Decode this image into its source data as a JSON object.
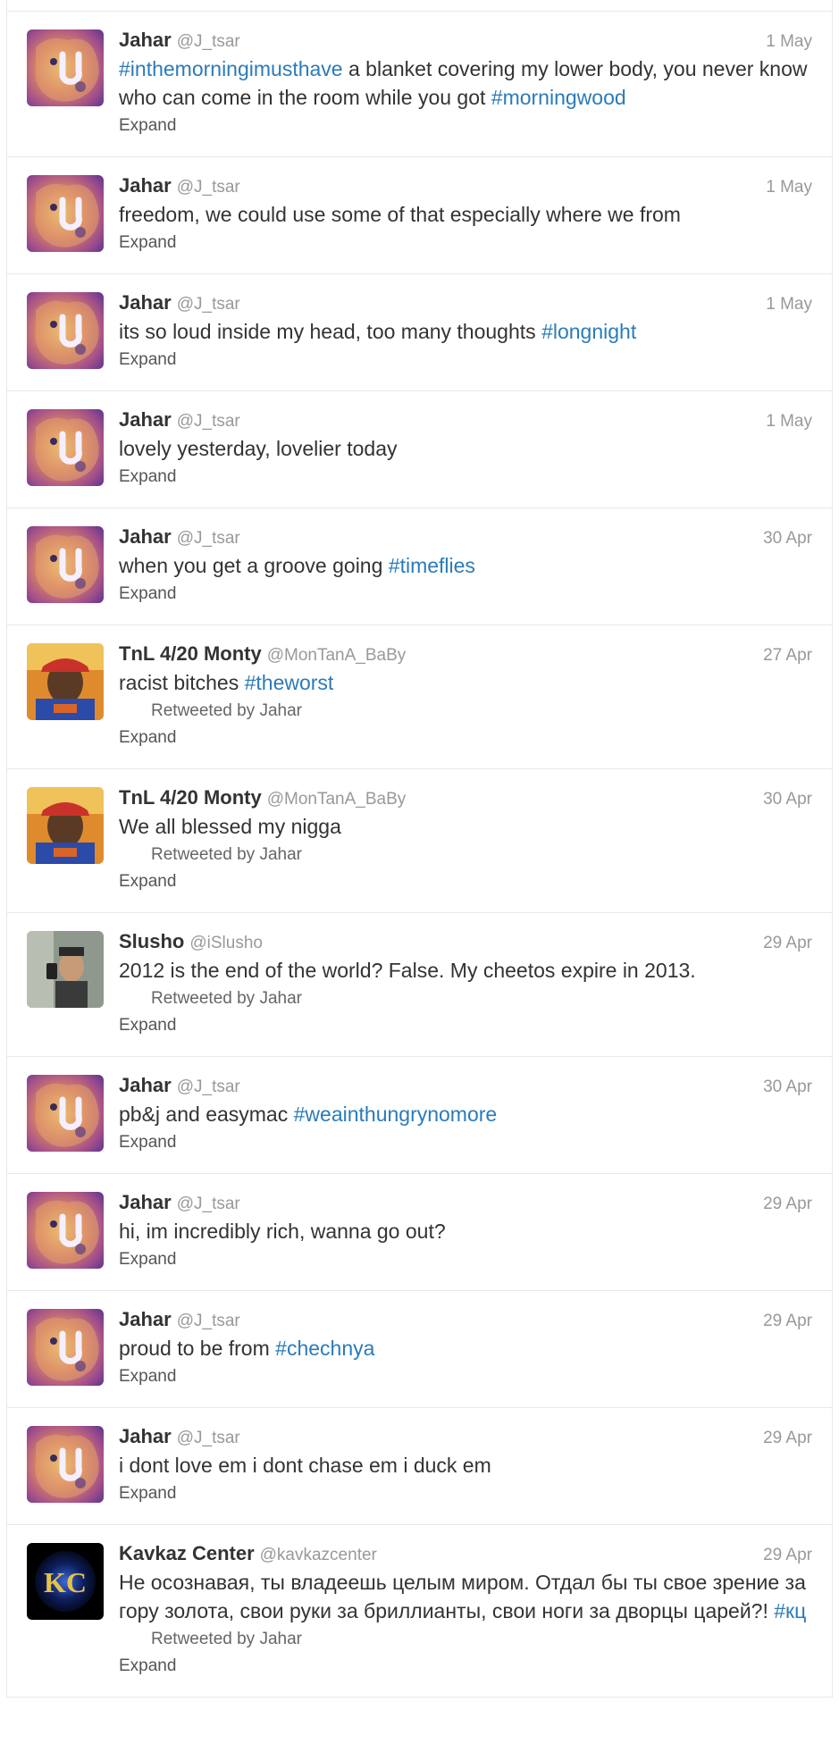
{
  "tweets": [
    {
      "avatar": "lion",
      "name": "Jahar",
      "handle": "@J_tsar",
      "time": "1 May",
      "text": [
        {
          "t": "#inthemorningimusthave",
          "tag": true
        },
        {
          "t": " a blanket covering my lower body, you never know who can come in the room while you got "
        },
        {
          "t": "#morningwood",
          "tag": true
        }
      ],
      "retweet": "",
      "expand": "Expand"
    },
    {
      "avatar": "lion",
      "name": "Jahar",
      "handle": "@J_tsar",
      "time": "1 May",
      "text": [
        {
          "t": "freedom, we could use some of that especially where we from"
        }
      ],
      "retweet": "",
      "expand": "Expand"
    },
    {
      "avatar": "lion",
      "name": "Jahar",
      "handle": "@J_tsar",
      "time": "1 May",
      "text": [
        {
          "t": "its so loud inside my head, too many thoughts "
        },
        {
          "t": "#longnight",
          "tag": true
        }
      ],
      "retweet": "",
      "expand": "Expand"
    },
    {
      "avatar": "lion",
      "name": "Jahar",
      "handle": "@J_tsar",
      "time": "1 May",
      "text": [
        {
          "t": "lovely yesterday, lovelier today"
        }
      ],
      "retweet": "",
      "expand": "Expand"
    },
    {
      "avatar": "lion",
      "name": "Jahar",
      "handle": "@J_tsar",
      "time": "30 Apr",
      "text": [
        {
          "t": "when you get a groove going "
        },
        {
          "t": "#timeflies",
          "tag": true
        }
      ],
      "retweet": "",
      "expand": "Expand"
    },
    {
      "avatar": "monty",
      "name": "TnL 4/20 Monty",
      "handle": "@MonTanA_BaBy",
      "time": "27 Apr",
      "text": [
        {
          "t": "racist bitches "
        },
        {
          "t": "#theworst",
          "tag": true
        }
      ],
      "retweet": "Retweeted by Jahar",
      "expand": "Expand"
    },
    {
      "avatar": "monty",
      "name": "TnL 4/20 Monty",
      "handle": "@MonTanA_BaBy",
      "time": "30 Apr",
      "text": [
        {
          "t": "We all blessed my nigga"
        }
      ],
      "retweet": "Retweeted by Jahar",
      "expand": "Expand"
    },
    {
      "avatar": "slusho",
      "name": "Slusho",
      "handle": "@iSlusho",
      "time": "29 Apr",
      "text": [
        {
          "t": "2012 is the end of the world? False. My cheetos expire in 2013."
        }
      ],
      "retweet": "Retweeted by Jahar",
      "expand": "Expand"
    },
    {
      "avatar": "lion",
      "name": "Jahar",
      "handle": "@J_tsar",
      "time": "30 Apr",
      "text": [
        {
          "t": "pb&j and easymac "
        },
        {
          "t": "#weainthungrynomore",
          "tag": true
        }
      ],
      "retweet": "",
      "expand": "Expand"
    },
    {
      "avatar": "lion",
      "name": "Jahar",
      "handle": "@J_tsar",
      "time": "29 Apr",
      "text": [
        {
          "t": "hi, im incredibly rich, wanna go out?"
        }
      ],
      "retweet": "",
      "expand": "Expand"
    },
    {
      "avatar": "lion",
      "name": "Jahar",
      "handle": "@J_tsar",
      "time": "29 Apr",
      "text": [
        {
          "t": "proud to be from "
        },
        {
          "t": "#chechnya",
          "tag": true
        }
      ],
      "retweet": "",
      "expand": "Expand"
    },
    {
      "avatar": "lion",
      "name": "Jahar",
      "handle": "@J_tsar",
      "time": "29 Apr",
      "text": [
        {
          "t": "i dont love em i dont chase em i duck em"
        }
      ],
      "retweet": "",
      "expand": "Expand"
    },
    {
      "avatar": "kc",
      "name": "Kavkaz Center",
      "handle": "@kavkazcenter",
      "time": "29 Apr",
      "text": [
        {
          "t": "Не осознавая, ты владеешь целым миром. Отдал бы ты свое зрение за гору золота, свои руки за бриллианты, свои ноги за дворцы царей?! "
        },
        {
          "t": "#кц",
          "tag": true
        }
      ],
      "retweet": "Retweeted by Jahar",
      "expand": "Expand"
    }
  ],
  "colors": {
    "hashtag": "#2b7bb9",
    "border": "#e8e8e8",
    "muted": "#999999"
  },
  "avatar_logo_text": "KC"
}
